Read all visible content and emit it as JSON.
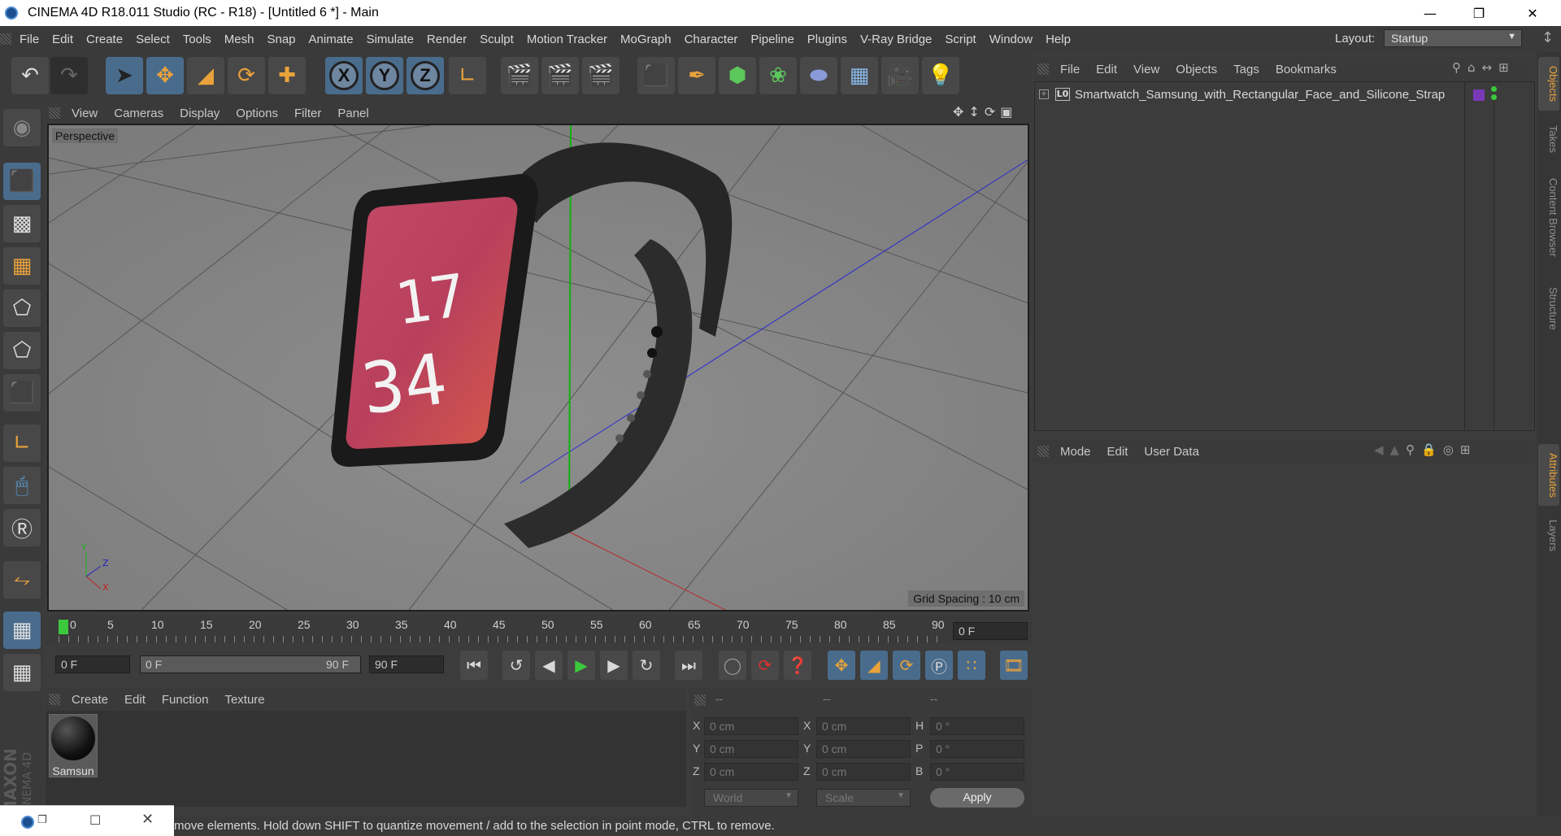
{
  "window": {
    "title": "CINEMA 4D R18.011 Studio (RC - R18) - [Untitled 6 *] - Main"
  },
  "menubar": {
    "items": [
      "File",
      "Edit",
      "Create",
      "Select",
      "Tools",
      "Mesh",
      "Snap",
      "Animate",
      "Simulate",
      "Render",
      "Sculpt",
      "Motion Tracker",
      "MoGraph",
      "Character",
      "Pipeline",
      "Plugins",
      "V-Ray Bridge",
      "Script",
      "Window",
      "Help"
    ],
    "layout_label": "Layout:",
    "layout_value": "Startup"
  },
  "viewport": {
    "menu": [
      "View",
      "Cameras",
      "Display",
      "Options",
      "Filter",
      "Panel"
    ],
    "camera_label": "Perspective",
    "grid_spacing": "Grid Spacing : 10 cm",
    "watch_hour": "17",
    "watch_minute": "34",
    "axis_labels": {
      "x": "X",
      "y": "Y",
      "z": "Z"
    }
  },
  "timeline": {
    "ticks": [
      "0",
      "5",
      "10",
      "15",
      "20",
      "25",
      "30",
      "35",
      "40",
      "45",
      "50",
      "55",
      "60",
      "65",
      "70",
      "75",
      "80",
      "85",
      "90"
    ],
    "current_frame": "0 F",
    "start_frame": "0 F",
    "range_start": "0 F",
    "range_end": "90 F",
    "end_frame": "90 F"
  },
  "materials": {
    "menu": [
      "Create",
      "Edit",
      "Function",
      "Texture"
    ],
    "items": [
      {
        "label": "Samsun"
      }
    ]
  },
  "coordinates": {
    "headers": [
      "--",
      "--",
      "--"
    ],
    "rows": [
      {
        "l1": "X",
        "v1": "0 cm",
        "l2": "X",
        "v2": "0 cm",
        "l3": "H",
        "v3": "0 °"
      },
      {
        "l1": "Y",
        "v1": "0 cm",
        "l2": "Y",
        "v2": "0 cm",
        "l3": "P",
        "v3": "0 °"
      },
      {
        "l1": "Z",
        "v1": "0 cm",
        "l2": "Z",
        "v2": "0 cm",
        "l3": "B",
        "v3": "0 °"
      }
    ],
    "space": "World",
    "mode": "Scale",
    "apply": "Apply"
  },
  "object_manager": {
    "menu": [
      "File",
      "Edit",
      "View",
      "Objects",
      "Tags",
      "Bookmarks"
    ],
    "objects": [
      {
        "name": "Smartwatch_Samsung_with_Rectangular_Face_and_Silicone_Strap",
        "layer_badge": "L0"
      }
    ]
  },
  "attributes": {
    "menu": [
      "Mode",
      "Edit",
      "User Data"
    ]
  },
  "right_tabs": {
    "top": [
      "Objects",
      "Takes",
      "Content Browser",
      "Structure"
    ],
    "bottom": [
      "Attributes",
      "Layers"
    ]
  },
  "status": {
    "text": "move elements. Hold down SHIFT to quantize movement / add to the selection in point mode, CTRL to remove."
  },
  "branding": {
    "maxon": "MAXON",
    "cinema": "CINEMA 4D"
  },
  "colors": {
    "accent": "#e9a23b",
    "selected_button": "#4a6c8c",
    "play": "#3cc83c",
    "x_axis": "#d02020",
    "y_axis": "#20c020",
    "z_axis": "#2020d0"
  }
}
